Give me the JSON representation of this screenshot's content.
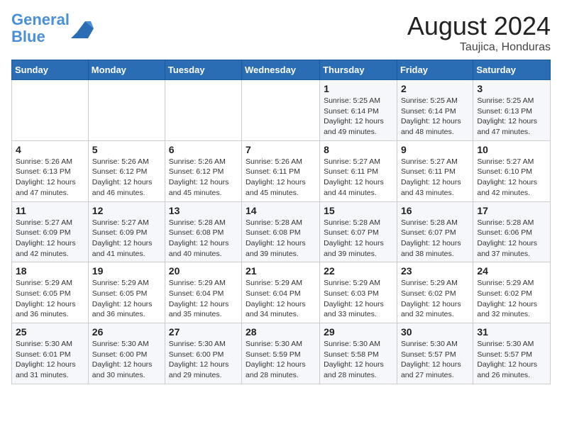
{
  "header": {
    "logo_line1": "General",
    "logo_line2": "Blue",
    "month_year": "August 2024",
    "location": "Taujica, Honduras"
  },
  "days_of_week": [
    "Sunday",
    "Monday",
    "Tuesday",
    "Wednesday",
    "Thursday",
    "Friday",
    "Saturday"
  ],
  "weeks": [
    [
      {
        "day": "",
        "sunrise": "",
        "sunset": "",
        "daylight": ""
      },
      {
        "day": "",
        "sunrise": "",
        "sunset": "",
        "daylight": ""
      },
      {
        "day": "",
        "sunrise": "",
        "sunset": "",
        "daylight": ""
      },
      {
        "day": "",
        "sunrise": "",
        "sunset": "",
        "daylight": ""
      },
      {
        "day": "1",
        "sunrise": "5:25 AM",
        "sunset": "6:14 PM",
        "daylight": "12 hours and 49 minutes."
      },
      {
        "day": "2",
        "sunrise": "5:25 AM",
        "sunset": "6:14 PM",
        "daylight": "12 hours and 48 minutes."
      },
      {
        "day": "3",
        "sunrise": "5:25 AM",
        "sunset": "6:13 PM",
        "daylight": "12 hours and 47 minutes."
      }
    ],
    [
      {
        "day": "4",
        "sunrise": "5:26 AM",
        "sunset": "6:13 PM",
        "daylight": "12 hours and 47 minutes."
      },
      {
        "day": "5",
        "sunrise": "5:26 AM",
        "sunset": "6:12 PM",
        "daylight": "12 hours and 46 minutes."
      },
      {
        "day": "6",
        "sunrise": "5:26 AM",
        "sunset": "6:12 PM",
        "daylight": "12 hours and 45 minutes."
      },
      {
        "day": "7",
        "sunrise": "5:26 AM",
        "sunset": "6:11 PM",
        "daylight": "12 hours and 45 minutes."
      },
      {
        "day": "8",
        "sunrise": "5:27 AM",
        "sunset": "6:11 PM",
        "daylight": "12 hours and 44 minutes."
      },
      {
        "day": "9",
        "sunrise": "5:27 AM",
        "sunset": "6:11 PM",
        "daylight": "12 hours and 43 minutes."
      },
      {
        "day": "10",
        "sunrise": "5:27 AM",
        "sunset": "6:10 PM",
        "daylight": "12 hours and 42 minutes."
      }
    ],
    [
      {
        "day": "11",
        "sunrise": "5:27 AM",
        "sunset": "6:09 PM",
        "daylight": "12 hours and 42 minutes."
      },
      {
        "day": "12",
        "sunrise": "5:27 AM",
        "sunset": "6:09 PM",
        "daylight": "12 hours and 41 minutes."
      },
      {
        "day": "13",
        "sunrise": "5:28 AM",
        "sunset": "6:08 PM",
        "daylight": "12 hours and 40 minutes."
      },
      {
        "day": "14",
        "sunrise": "5:28 AM",
        "sunset": "6:08 PM",
        "daylight": "12 hours and 39 minutes."
      },
      {
        "day": "15",
        "sunrise": "5:28 AM",
        "sunset": "6:07 PM",
        "daylight": "12 hours and 39 minutes."
      },
      {
        "day": "16",
        "sunrise": "5:28 AM",
        "sunset": "6:07 PM",
        "daylight": "12 hours and 38 minutes."
      },
      {
        "day": "17",
        "sunrise": "5:28 AM",
        "sunset": "6:06 PM",
        "daylight": "12 hours and 37 minutes."
      }
    ],
    [
      {
        "day": "18",
        "sunrise": "5:29 AM",
        "sunset": "6:05 PM",
        "daylight": "12 hours and 36 minutes."
      },
      {
        "day": "19",
        "sunrise": "5:29 AM",
        "sunset": "6:05 PM",
        "daylight": "12 hours and 36 minutes."
      },
      {
        "day": "20",
        "sunrise": "5:29 AM",
        "sunset": "6:04 PM",
        "daylight": "12 hours and 35 minutes."
      },
      {
        "day": "21",
        "sunrise": "5:29 AM",
        "sunset": "6:04 PM",
        "daylight": "12 hours and 34 minutes."
      },
      {
        "day": "22",
        "sunrise": "5:29 AM",
        "sunset": "6:03 PM",
        "daylight": "12 hours and 33 minutes."
      },
      {
        "day": "23",
        "sunrise": "5:29 AM",
        "sunset": "6:02 PM",
        "daylight": "12 hours and 32 minutes."
      },
      {
        "day": "24",
        "sunrise": "5:29 AM",
        "sunset": "6:02 PM",
        "daylight": "12 hours and 32 minutes."
      }
    ],
    [
      {
        "day": "25",
        "sunrise": "5:30 AM",
        "sunset": "6:01 PM",
        "daylight": "12 hours and 31 minutes."
      },
      {
        "day": "26",
        "sunrise": "5:30 AM",
        "sunset": "6:00 PM",
        "daylight": "12 hours and 30 minutes."
      },
      {
        "day": "27",
        "sunrise": "5:30 AM",
        "sunset": "6:00 PM",
        "daylight": "12 hours and 29 minutes."
      },
      {
        "day": "28",
        "sunrise": "5:30 AM",
        "sunset": "5:59 PM",
        "daylight": "12 hours and 28 minutes."
      },
      {
        "day": "29",
        "sunrise": "5:30 AM",
        "sunset": "5:58 PM",
        "daylight": "12 hours and 28 minutes."
      },
      {
        "day": "30",
        "sunrise": "5:30 AM",
        "sunset": "5:57 PM",
        "daylight": "12 hours and 27 minutes."
      },
      {
        "day": "31",
        "sunrise": "5:30 AM",
        "sunset": "5:57 PM",
        "daylight": "12 hours and 26 minutes."
      }
    ]
  ]
}
